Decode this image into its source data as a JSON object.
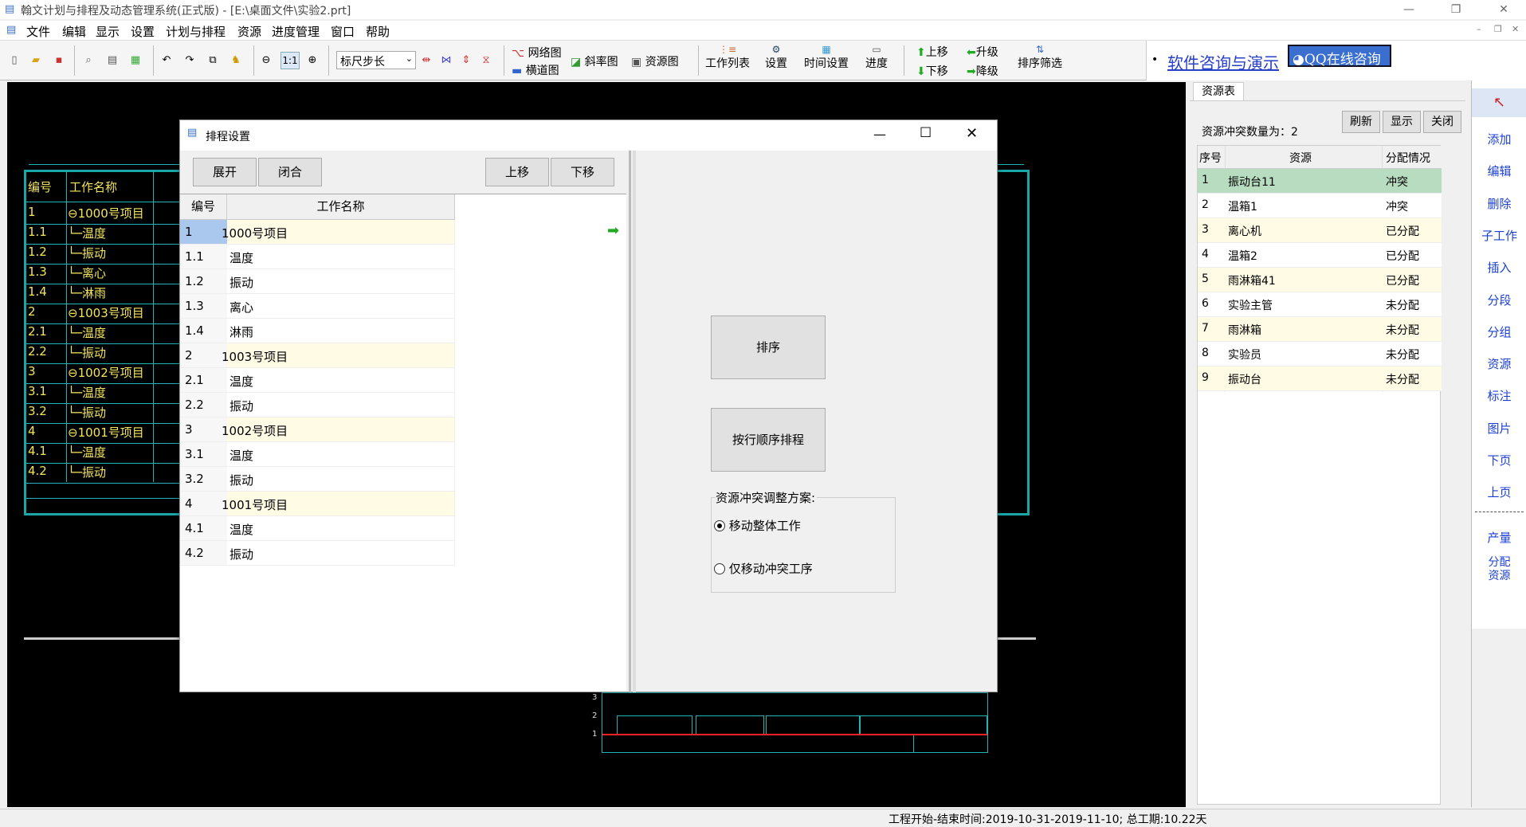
{
  "app": {
    "title": "翰文计划与排程及动态管理系统(正式版) - [E:\\桌面文件\\实验2.prt]"
  },
  "menu": [
    "文件",
    "编辑",
    "显示",
    "设置",
    "计划与排程",
    "资源",
    "进度管理",
    "窗口",
    "帮助"
  ],
  "toolbar": {
    "zoom_label": "1:1",
    "scale_select": "标尺步长",
    "network": "网络图",
    "gantt": "横道图",
    "slope": "斜率图",
    "resource": "资源图",
    "worklist": "工作列表",
    "settings": "设置",
    "time_settings": "时间设置",
    "progress": "进度",
    "move_up": "上移",
    "move_down": "下移",
    "upgrade": "升级",
    "downgrade": "降级",
    "sort_filter": "排序筛选",
    "consult_link": "软件咨询与演示",
    "qq_btn": "QQ在线咨询"
  },
  "canvas": {
    "header": [
      "编号",
      "工作名称"
    ],
    "rows": [
      {
        "no": "1",
        "name": "⊖1000号项目"
      },
      {
        "no": "1.1",
        "name": "└─温度"
      },
      {
        "no": "1.2",
        "name": "└─振动"
      },
      {
        "no": "1.3",
        "name": "└─离心"
      },
      {
        "no": "1.4",
        "name": "└─淋雨"
      },
      {
        "no": "2",
        "name": "⊖1003号项目"
      },
      {
        "no": "2.1",
        "name": "└─温度"
      },
      {
        "no": "2.2",
        "name": "└─振动"
      },
      {
        "no": "3",
        "name": "⊖1002号项目"
      },
      {
        "no": "3.1",
        "name": "└─温度"
      },
      {
        "no": "3.2",
        "name": "└─振动"
      },
      {
        "no": "4",
        "name": "⊖1001号项目"
      },
      {
        "no": "4.1",
        "name": "└─温度"
      },
      {
        "no": "4.2",
        "name": "└─振动"
      }
    ],
    "mini_axis": [
      "3",
      "2",
      "1"
    ]
  },
  "dialog": {
    "title": "排程设置",
    "expand": "展开",
    "collapse": "闭合",
    "up": "上移",
    "down": "下移",
    "col_no": "编号",
    "col_name": "工作名称",
    "rows": [
      {
        "no": "1",
        "name": "1000号项目",
        "group": true
      },
      {
        "no": "1.1",
        "name": "温度"
      },
      {
        "no": "1.2",
        "name": "振动"
      },
      {
        "no": "1.3",
        "name": "离心"
      },
      {
        "no": "1.4",
        "name": "淋雨"
      },
      {
        "no": "2",
        "name": "1003号项目",
        "group": true
      },
      {
        "no": "2.1",
        "name": "温度"
      },
      {
        "no": "2.2",
        "name": "振动"
      },
      {
        "no": "3",
        "name": "1002号项目",
        "group": true
      },
      {
        "no": "3.1",
        "name": "温度"
      },
      {
        "no": "3.2",
        "name": "振动"
      },
      {
        "no": "4",
        "name": "1001号项目",
        "group": true
      },
      {
        "no": "4.1",
        "name": "温度"
      },
      {
        "no": "4.2",
        "name": "振动"
      }
    ],
    "sort_btn": "排序",
    "sort_by_row_btn": "按行顺序排程",
    "conflict_group": "资源冲突调整方案:",
    "opt1": "移动整体工作",
    "opt2": "仅移动冲突工序"
  },
  "resource_panel": {
    "tab": "资源表",
    "conflict_label": "资源冲突数量为：2",
    "refresh": "刷新",
    "show": "显示",
    "close": "关闭",
    "headers": [
      "序号",
      "资源",
      "分配情况"
    ],
    "rows": [
      {
        "no": "1",
        "name": "振动台11",
        "status": "冲突"
      },
      {
        "no": "2",
        "name": "温箱1",
        "status": "冲突"
      },
      {
        "no": "3",
        "name": "离心机",
        "status": "已分配"
      },
      {
        "no": "4",
        "name": "温箱2",
        "status": "已分配"
      },
      {
        "no": "5",
        "name": "雨淋箱41",
        "status": "已分配"
      },
      {
        "no": "6",
        "name": "实验主管",
        "status": "未分配"
      },
      {
        "no": "7",
        "name": "雨淋箱",
        "status": "未分配"
      },
      {
        "no": "8",
        "name": "实验员",
        "status": "未分配"
      },
      {
        "no": "9",
        "name": "振动台",
        "status": "未分配"
      }
    ]
  },
  "sidebar": [
    "添加",
    "编辑",
    "删除",
    "子工作",
    "插入",
    "分段",
    "分组",
    "资源",
    "标注",
    "图片",
    "下页",
    "上页"
  ],
  "sidebar_bottom": [
    "产量",
    "分配\n资源"
  ],
  "status_text": "工程开始-结束时间:2019-10-31-2019-11-10;  总工期:10.22天"
}
